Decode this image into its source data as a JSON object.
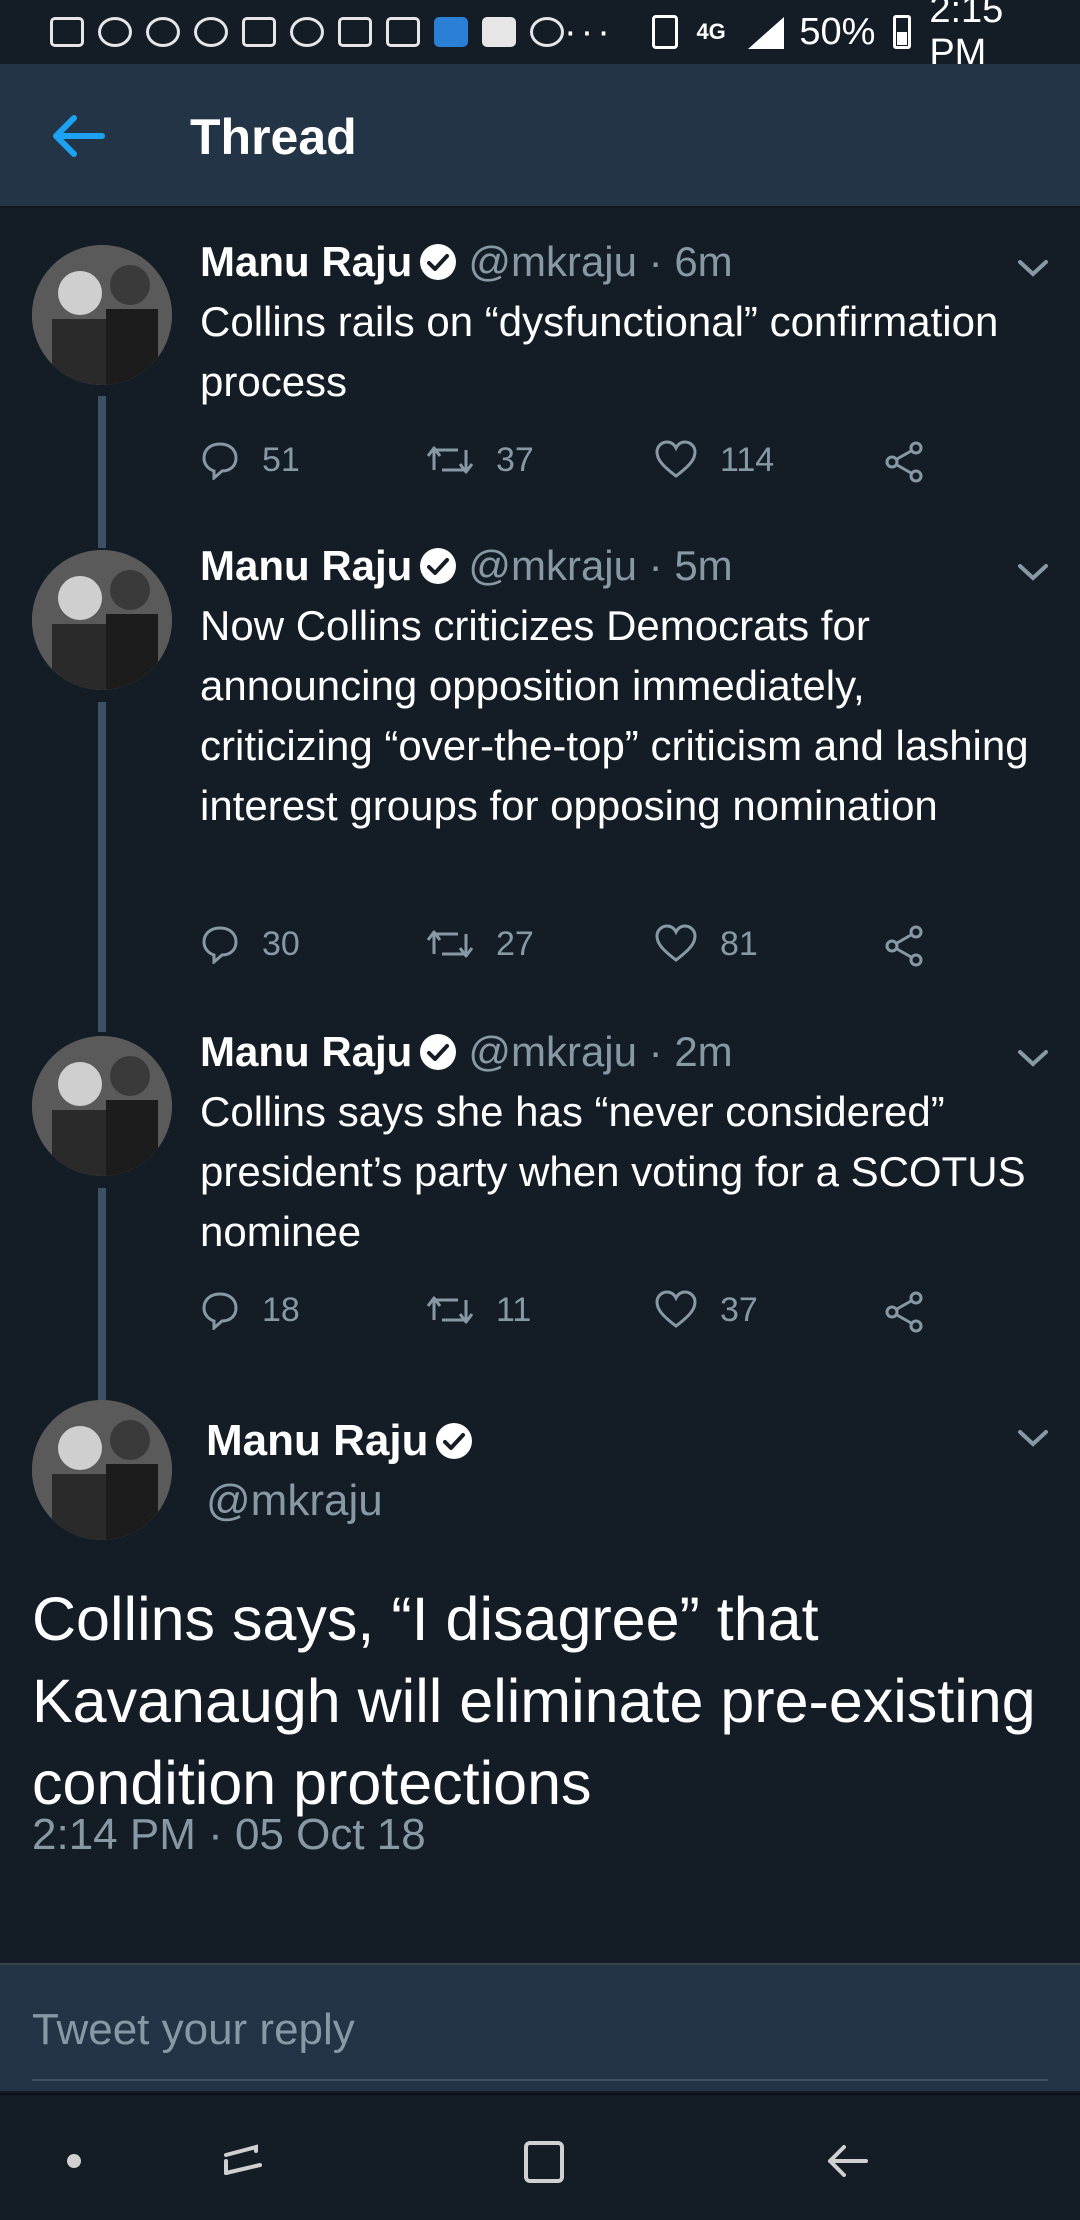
{
  "status_bar": {
    "time": "2:15 PM",
    "battery": "50%",
    "network": "4G",
    "more": "···"
  },
  "header": {
    "title": "Thread"
  },
  "tweets": [
    {
      "name": "Manu Raju",
      "handle": "@mkraju · 6m",
      "text": "Collins rails on “dysfunctional” confirmation process",
      "replies": "51",
      "retweets": "37",
      "likes": "114"
    },
    {
      "name": "Manu Raju",
      "handle": "@mkraju · 5m",
      "text": "Now Collins criticizes Democrats for announcing opposition immediately, criticizing “over-the-top” criticism and lashing interest groups for opposing nomination",
      "replies": "30",
      "retweets": "27",
      "likes": "81"
    },
    {
      "name": "Manu Raju",
      "handle": "@mkraju · 2m",
      "text": "Collins says she has “never considered” president’s party when voting for a SCOTUS nominee",
      "replies": "18",
      "retweets": "11",
      "likes": "37"
    }
  ],
  "main_tweet": {
    "name": "Manu Raju",
    "handle": "@mkraju",
    "text": "Collins says, “I disagree” that Kavanaugh will eliminate pre-existing condition protections",
    "timestamp": "2:14 PM · 05 Oct 18"
  },
  "reply": {
    "placeholder": "Tweet your reply"
  },
  "colors": {
    "background": "#141d26",
    "header": "#243447",
    "accent": "#1da1f2",
    "secondary_text": "#8899a6"
  }
}
